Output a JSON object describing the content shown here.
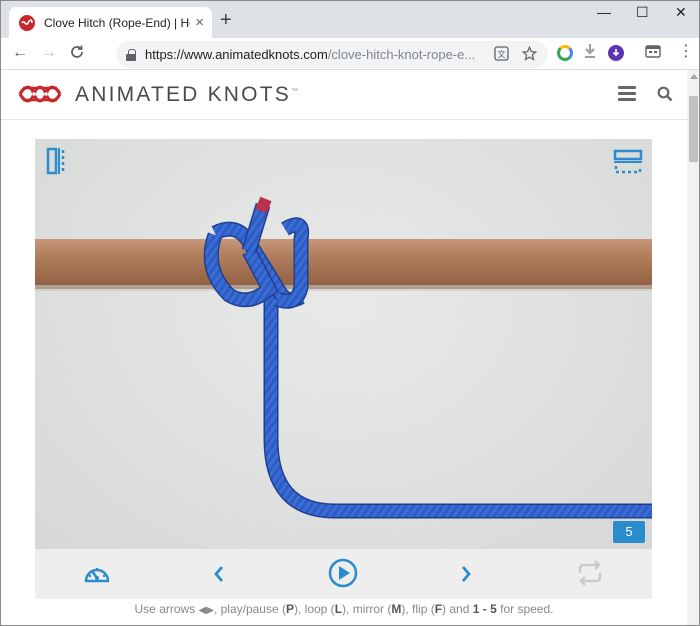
{
  "browser": {
    "tab_title": "Clove Hitch (Rope-End) | How t",
    "tab_close": "×",
    "new_tab": "+",
    "window_controls": {
      "minimize": "—",
      "maximize": "☐",
      "close": "✕"
    },
    "nav": {
      "back": "←",
      "forward": "→",
      "reload": "C"
    },
    "url_host": "https://www.animatedknots.com",
    "url_path": "/clove-hitch-knot-rope-e...",
    "menu_dots": "⋮"
  },
  "site": {
    "logo_text": "ANIMATED KNOTS",
    "logo_tm": "™"
  },
  "player": {
    "frame_number": "5"
  },
  "hint": {
    "prefix": "Use arrows",
    "play": "play/pause (",
    "play_key": "P",
    "loop": "), loop (",
    "loop_key": "L",
    "mirror": "), mirror (",
    "mirror_key": "M",
    "flip": "), flip (",
    "flip_key": "F",
    "and": ") and",
    "speed_keys": "1 - 5",
    "speed": "for speed."
  },
  "colors": {
    "accent": "#2a8ccc",
    "brand_red": "#c8282c",
    "rope_blue": "#2f5fc4",
    "pole": "#a87552"
  },
  "icons": [
    "speed-icon",
    "prev-icon",
    "play-icon",
    "next-icon",
    "loop-icon",
    "mirror-icon",
    "flip-icon",
    "menu-icon",
    "search-icon"
  ]
}
